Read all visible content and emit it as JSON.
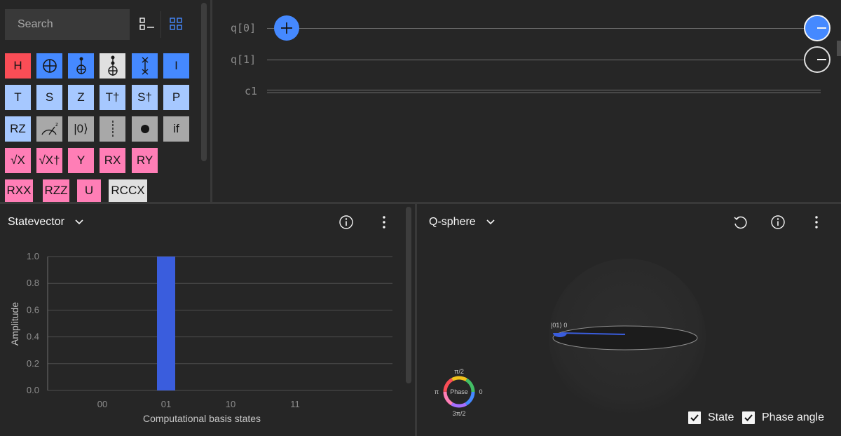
{
  "palette": {
    "search_placeholder": "Search",
    "gates": {
      "h": "H",
      "i": "I",
      "t": "T",
      "s": "S",
      "z": "Z",
      "tdg": "T†",
      "sdg": "S†",
      "p": "P",
      "rz": "RZ",
      "reset": "|0⟩",
      "if": "if",
      "sx": "√X",
      "sxdg": "√X†",
      "y": "Y",
      "rx": "RX",
      "ry": "RY",
      "rxx": "RXX",
      "rzz": "RZZ",
      "u": "U",
      "rccx": "RCCX"
    }
  },
  "circuit": {
    "qubits": [
      "q[0]",
      "q[1]"
    ],
    "classical": "c1"
  },
  "statevector": {
    "title": "Statevector",
    "chart_data": {
      "type": "bar",
      "categories": [
        "00",
        "01",
        "10",
        "11"
      ],
      "values": [
        0,
        1.0,
        0,
        0
      ],
      "xlabel": "Computational basis states",
      "ylabel": "Amplitude",
      "ylim": [
        0,
        1.0
      ],
      "yticks": [
        "0.0",
        "0.2",
        "0.4",
        "0.6",
        "0.8",
        "1.0"
      ],
      "bar_color": "#3a5ddd"
    }
  },
  "qsphere": {
    "title": "Q-sphere",
    "state_label": "|01⟩ 0",
    "phase": {
      "center": "Phase",
      "top": "π/2",
      "left": "π",
      "right": "0",
      "bottom": "3π/2"
    },
    "state_checkbox": "State",
    "phase_checkbox": "Phase angle"
  },
  "colors": {
    "accent": "#4589ff",
    "bar": "#3a5ddd",
    "background": "#262626"
  }
}
